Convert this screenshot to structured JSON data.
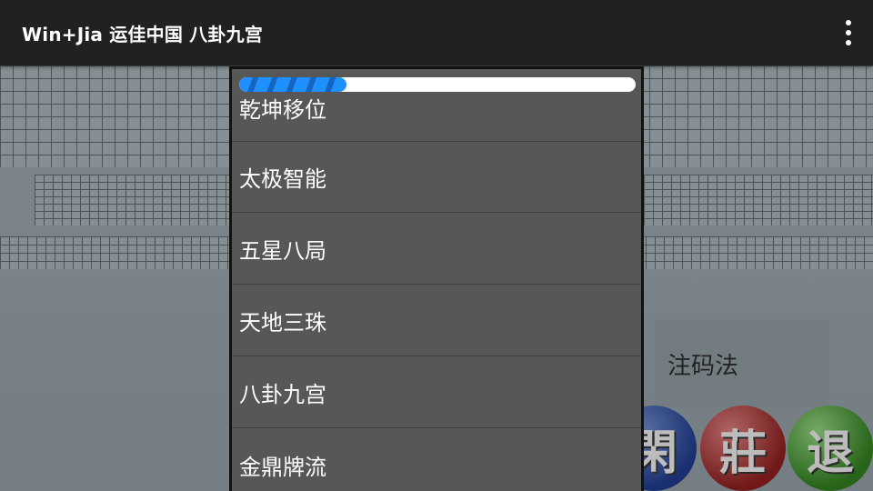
{
  "appbar": {
    "title": "Win+Jia 运佳中国 八卦九宫",
    "menu_icon": "overflow-menu-icon"
  },
  "background": {
    "notation_label": "注码法",
    "balls": [
      {
        "label": "閑",
        "color": "#1f3a8a"
      },
      {
        "label": "莊",
        "color": "#8a1f1f"
      },
      {
        "label": "退",
        "color": "#2f7a1f"
      }
    ]
  },
  "popup": {
    "progress_fraction": 0.27,
    "progress_color": "#1e90ff",
    "items": [
      {
        "label": "乾坤移位"
      },
      {
        "label": "太极智能"
      },
      {
        "label": "五星八局"
      },
      {
        "label": "天地三珠"
      },
      {
        "label": "八卦九宫"
      },
      {
        "label": "金鼎牌流"
      }
    ]
  }
}
